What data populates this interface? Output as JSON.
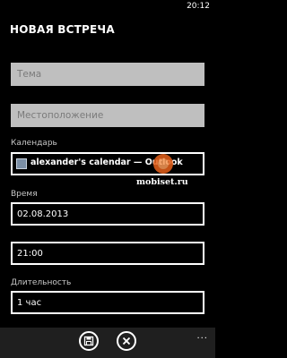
{
  "status_bar": {
    "time": "20:12"
  },
  "page": {
    "title": "НОВАЯ ВСТРЕЧА"
  },
  "fields": {
    "subject_placeholder": "Тема",
    "location_placeholder": "Местоположение",
    "calendar_label": "Календарь",
    "calendar_value": "alexander's calendar — Outlook",
    "time_label": "Время",
    "date_value": "02.08.2013",
    "time_value": "21:00",
    "duration_label": "Длительность",
    "duration_value": "1 час"
  },
  "watermark": {
    "text": "mobiset.ru"
  },
  "app_bar": {
    "more": "..."
  }
}
